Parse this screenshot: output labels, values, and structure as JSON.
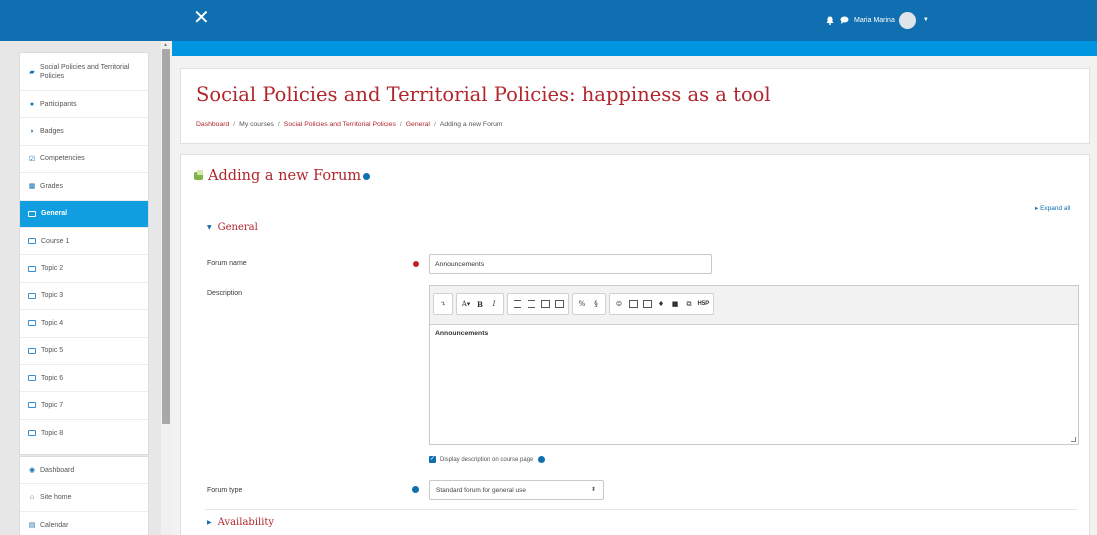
{
  "topbar": {
    "close_glyph": "✕",
    "user_name": "Maria Marina",
    "icons": [
      "bell-icon",
      "chat-icon",
      "avatar",
      "caret-down-icon"
    ]
  },
  "drawer": {
    "items": [
      {
        "label": "Social Policies and Territorial Policies",
        "icon": "graduation-cap-icon"
      },
      {
        "label": "Participants",
        "icon": "users-icon"
      },
      {
        "label": "Badges",
        "icon": "shield-icon"
      },
      {
        "label": "Competencies",
        "icon": "check-square-icon"
      },
      {
        "label": "Grades",
        "icon": "table-icon"
      },
      {
        "label": "General",
        "icon": "folder-icon",
        "active": true
      },
      {
        "label": "Course 1",
        "icon": "folder-icon"
      },
      {
        "label": "Topic 2",
        "icon": "folder-icon"
      },
      {
        "label": "Topic 3",
        "icon": "folder-icon"
      },
      {
        "label": "Topic 4",
        "icon": "folder-icon"
      },
      {
        "label": "Topic 5",
        "icon": "folder-icon"
      },
      {
        "label": "Topic 6",
        "icon": "folder-icon"
      },
      {
        "label": "Topic 7",
        "icon": "folder-icon"
      },
      {
        "label": "Topic 8",
        "icon": "folder-icon"
      }
    ],
    "items2": [
      {
        "label": "Dashboard",
        "icon": "dashboard-icon"
      },
      {
        "label": "Site home",
        "icon": "home-icon"
      },
      {
        "label": "Calendar",
        "icon": "calendar-icon"
      }
    ]
  },
  "header": {
    "title": "Social Policies and Territorial Policies: happiness as a tool",
    "breadcrumb": [
      "Dashboard",
      "My courses",
      "Social Policies and Territorial Policies",
      "General",
      "Adding a new Forum"
    ]
  },
  "form": {
    "heading": "Adding a new Forum",
    "expand_all": "Expand all",
    "section_general": "General",
    "section_availability": "Availability",
    "forum_name_label": "Forum name",
    "forum_name_value": "Announcements",
    "description_label": "Description",
    "description_content": "Announcements",
    "display_checkbox_label": "Display description on course page",
    "display_checked": true,
    "forum_type_label": "Forum type",
    "forum_type_value": "Standard forum for general use"
  },
  "colors": {
    "navbar": "#0f6fb0",
    "subbar": "#0095e0",
    "accent_red": "#b0262c",
    "active_nav": "#119ee0"
  }
}
